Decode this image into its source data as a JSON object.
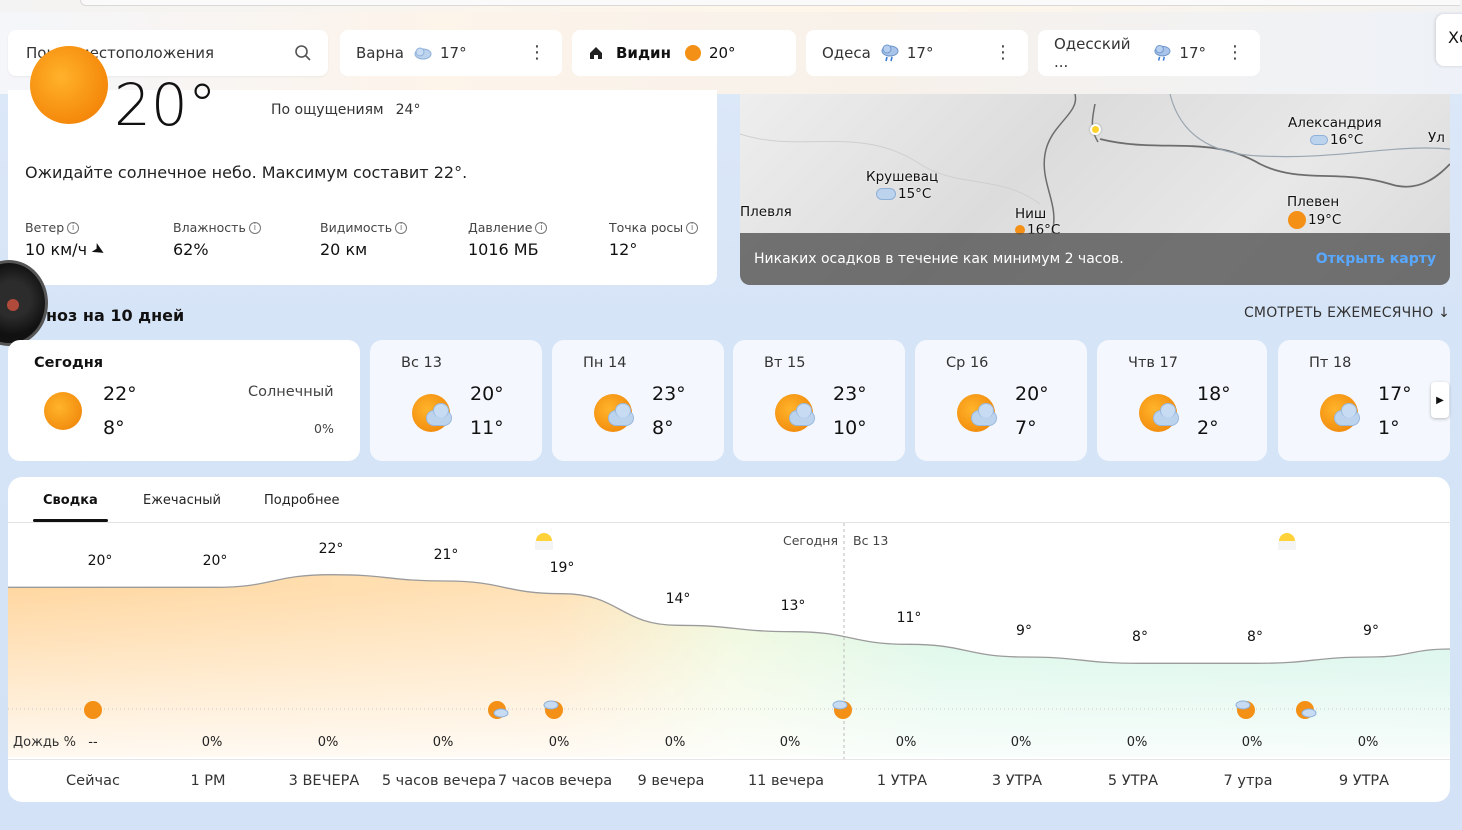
{
  "search": {
    "placeholder": "Поиск местоположения"
  },
  "locations": [
    {
      "name": "Варна",
      "temp": "17°",
      "icon": "cloud-icon"
    },
    {
      "name": "Видин",
      "temp": "20°",
      "icon": "sun-icon",
      "home": true
    },
    {
      "name": "Одеса",
      "temp": "17°",
      "icon": "rain-cloud-icon"
    },
    {
      "name": "Одесский ...",
      "temp": "17°",
      "icon": "rain-cloud-icon"
    }
  ],
  "edge_button": "Хо",
  "current": {
    "temp": "20°",
    "feels_label": "По ощущениям",
    "feels_value": "24°",
    "summary": "Ожидайте солнечное небо. Максимум составит 22°.",
    "metrics": [
      {
        "label": "Ветер",
        "value": "10 км/ч"
      },
      {
        "label": "Влажность",
        "value": "62%"
      },
      {
        "label": "Видимость",
        "value": "20 км"
      },
      {
        "label": "Давление",
        "value": "1016 МБ"
      },
      {
        "label": "Точка росы",
        "value": "12°"
      }
    ]
  },
  "map": {
    "labels": [
      {
        "name": "Александрия",
        "temp": "16°C"
      },
      {
        "name": "Крушевац",
        "temp": "15°C"
      },
      {
        "name": "Плевля"
      },
      {
        "name": "Ниш",
        "temp": "16°C"
      },
      {
        "name": "Плевен",
        "temp": "19°C"
      },
      {
        "name": "Ул"
      }
    ],
    "footer": "Никаких осадков в течение как минимум 2 часов.",
    "open_link": "Открыть карту"
  },
  "forecast": {
    "title": "ноз на 10 дней",
    "monthly": "СМОТРЕТЬ ЕЖЕМЕСЯЧНО ↓",
    "days": [
      {
        "name": "Сегодня",
        "hi": "22°",
        "lo": "8°",
        "cond": "Солнечный",
        "pct": "0%",
        "icon": "sun-icon"
      },
      {
        "name": "Вс 13",
        "hi": "20°",
        "lo": "11°",
        "icon": "partly-cloudy-icon"
      },
      {
        "name": "Пн 14",
        "hi": "23°",
        "lo": "8°",
        "icon": "partly-cloudy-icon"
      },
      {
        "name": "Вт 15",
        "hi": "23°",
        "lo": "10°",
        "icon": "partly-cloudy-icon"
      },
      {
        "name": "Ср 16",
        "hi": "20°",
        "lo": "7°",
        "icon": "partly-cloudy-icon"
      },
      {
        "name": "Чтв 17",
        "hi": "18°",
        "lo": "2°",
        "icon": "partly-cloudy-icon"
      },
      {
        "name": "Пт 18",
        "hi": "17°",
        "lo": "1°",
        "icon": "partly-cloudy-icon"
      }
    ]
  },
  "hourly": {
    "tabs": [
      "Сводка",
      "Ежечасный",
      "Подробнее"
    ],
    "today_label": "Сегодня",
    "next_label": "Вс 13",
    "rain_label": "Дождь %",
    "times": [
      "Сейчас",
      "1 PM",
      "3 ВЕЧЕРА",
      "5 часов вечера",
      "7 часов вечера",
      "9 вечера",
      "11 вечера",
      "1 УТРА",
      "3 УТРА",
      "5 УТРА",
      "7 утра",
      "9 УТРА"
    ],
    "temps_label": [
      "20°",
      "20°",
      "22°",
      "21°",
      "19°",
      "14°",
      "13°",
      "11°",
      "9°",
      "8°",
      "8°",
      "9°"
    ],
    "rain": [
      "--",
      "0%",
      "0%",
      "0%",
      "0%",
      "0%",
      "0%",
      "0%",
      "0%",
      "0%",
      "0%",
      "0%"
    ]
  },
  "chart_data": {
    "type": "area",
    "x": [
      "Сейчас",
      "1 PM",
      "3 ВЕЧЕРА",
      "5 часов вечера",
      "7 часов вечера",
      "9 вечера",
      "11 вечера",
      "1 УТРА",
      "3 УТРА",
      "5 УТРА",
      "7 утра",
      "9 УТРА"
    ],
    "series": [
      {
        "values": [
          20,
          20,
          22,
          21,
          19,
          14,
          13,
          11,
          9,
          8,
          8,
          9
        ]
      }
    ],
    "ylim": [
      0,
      30
    ],
    "grid": false
  },
  "colors": {
    "accent": "#f28c0e",
    "link": "#58a8ff",
    "warm": "#ffd39a",
    "cool": "#c8f2e0"
  }
}
